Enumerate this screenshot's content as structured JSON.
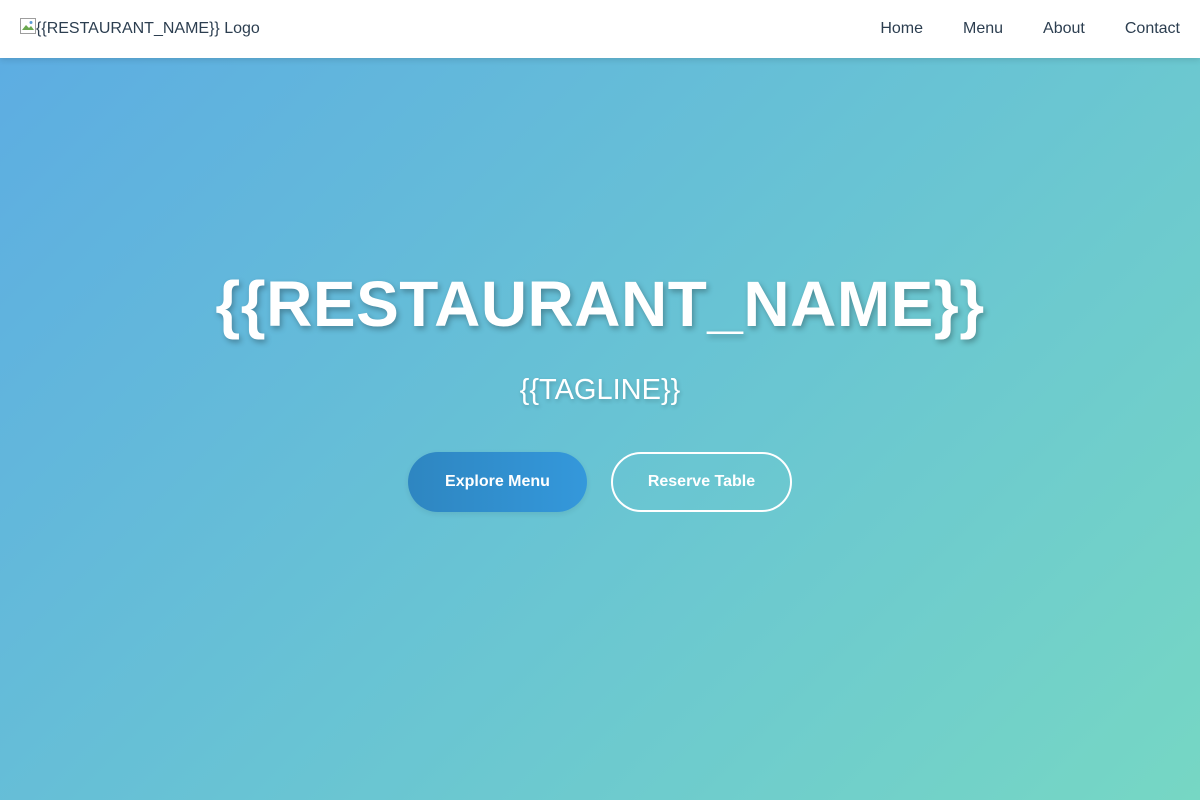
{
  "navbar": {
    "logo_alt": "{{RESTAURANT_NAME}} Logo",
    "links": [
      {
        "label": "Home"
      },
      {
        "label": "Menu"
      },
      {
        "label": "About"
      },
      {
        "label": "Contact"
      }
    ]
  },
  "hero": {
    "title": "{{RESTAURANT_NAME}}",
    "tagline": "{{TAGLINE}}",
    "primary_button": "Explore Menu",
    "secondary_button": "Reserve Table"
  },
  "colors": {
    "nav_text": "#2c3e50",
    "gradient_start": "#5dade2",
    "gradient_end": "#76d7c4",
    "primary_button": "#3498db"
  },
  "icons": {
    "logo": "broken-image-icon"
  }
}
